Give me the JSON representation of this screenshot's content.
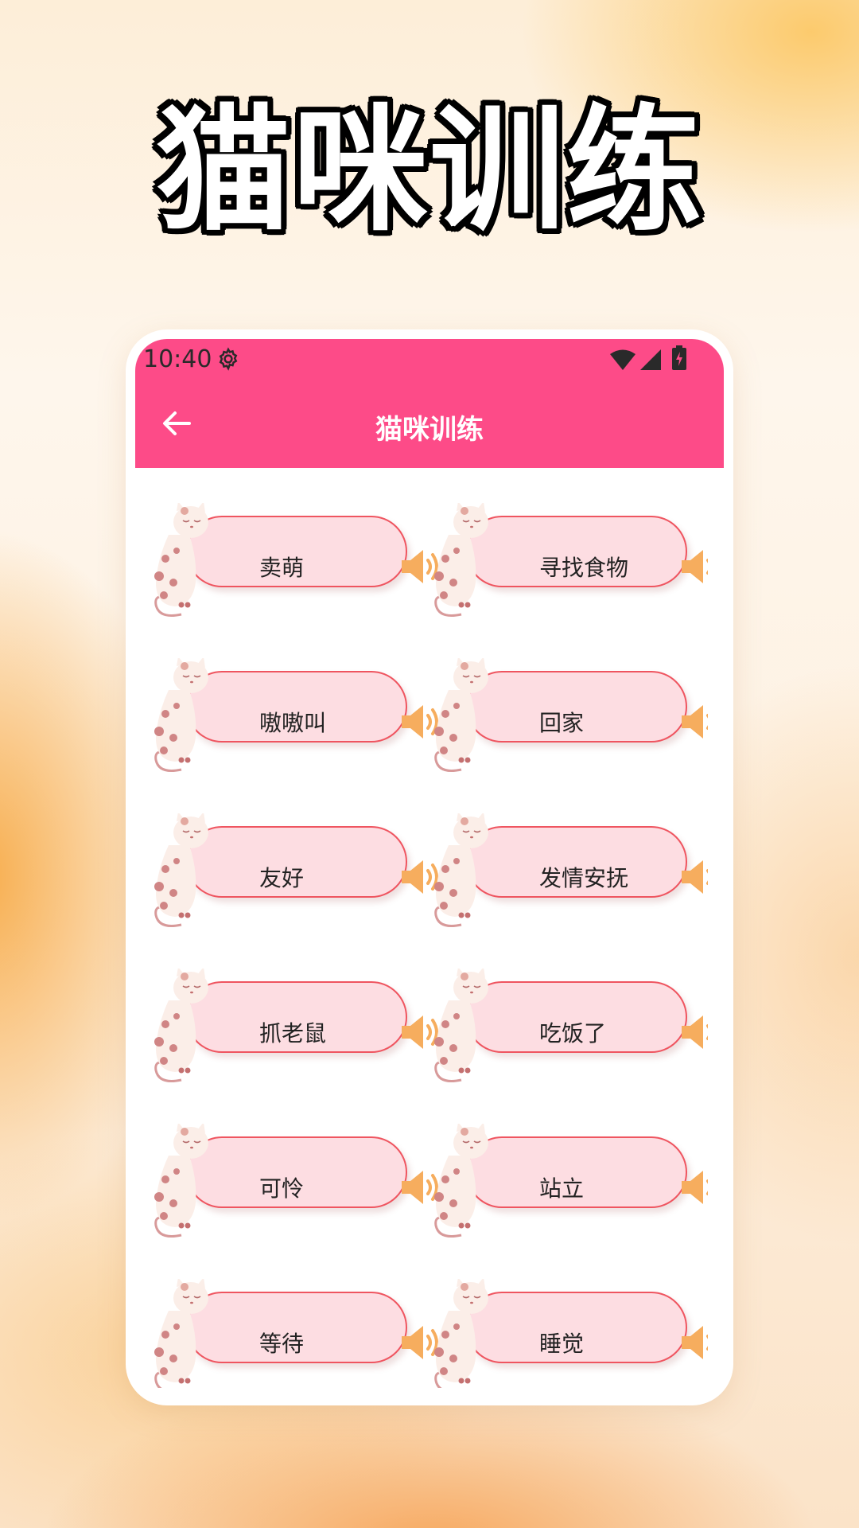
{
  "promo": {
    "title": "猫咪训练"
  },
  "status_bar": {
    "time": "10:40",
    "icons": [
      "gear-icon",
      "wifi-icon",
      "signal-icon",
      "battery-icon"
    ]
  },
  "app_bar": {
    "title": "猫咪训练",
    "back_icon": "arrow-left-icon"
  },
  "colors": {
    "accent": "#fd4b88",
    "pill_bg": "#fddde2",
    "pill_border": "#ef5560",
    "speaker": "#f6ad5e"
  },
  "items": [
    {
      "label": "卖萌"
    },
    {
      "label": "寻找食物"
    },
    {
      "label": "嗷嗷叫"
    },
    {
      "label": "回家"
    },
    {
      "label": "友好"
    },
    {
      "label": "发情安抚"
    },
    {
      "label": "抓老鼠"
    },
    {
      "label": "吃饭了"
    },
    {
      "label": "可怜"
    },
    {
      "label": "站立"
    },
    {
      "label": "等待"
    },
    {
      "label": "睡觉"
    }
  ]
}
